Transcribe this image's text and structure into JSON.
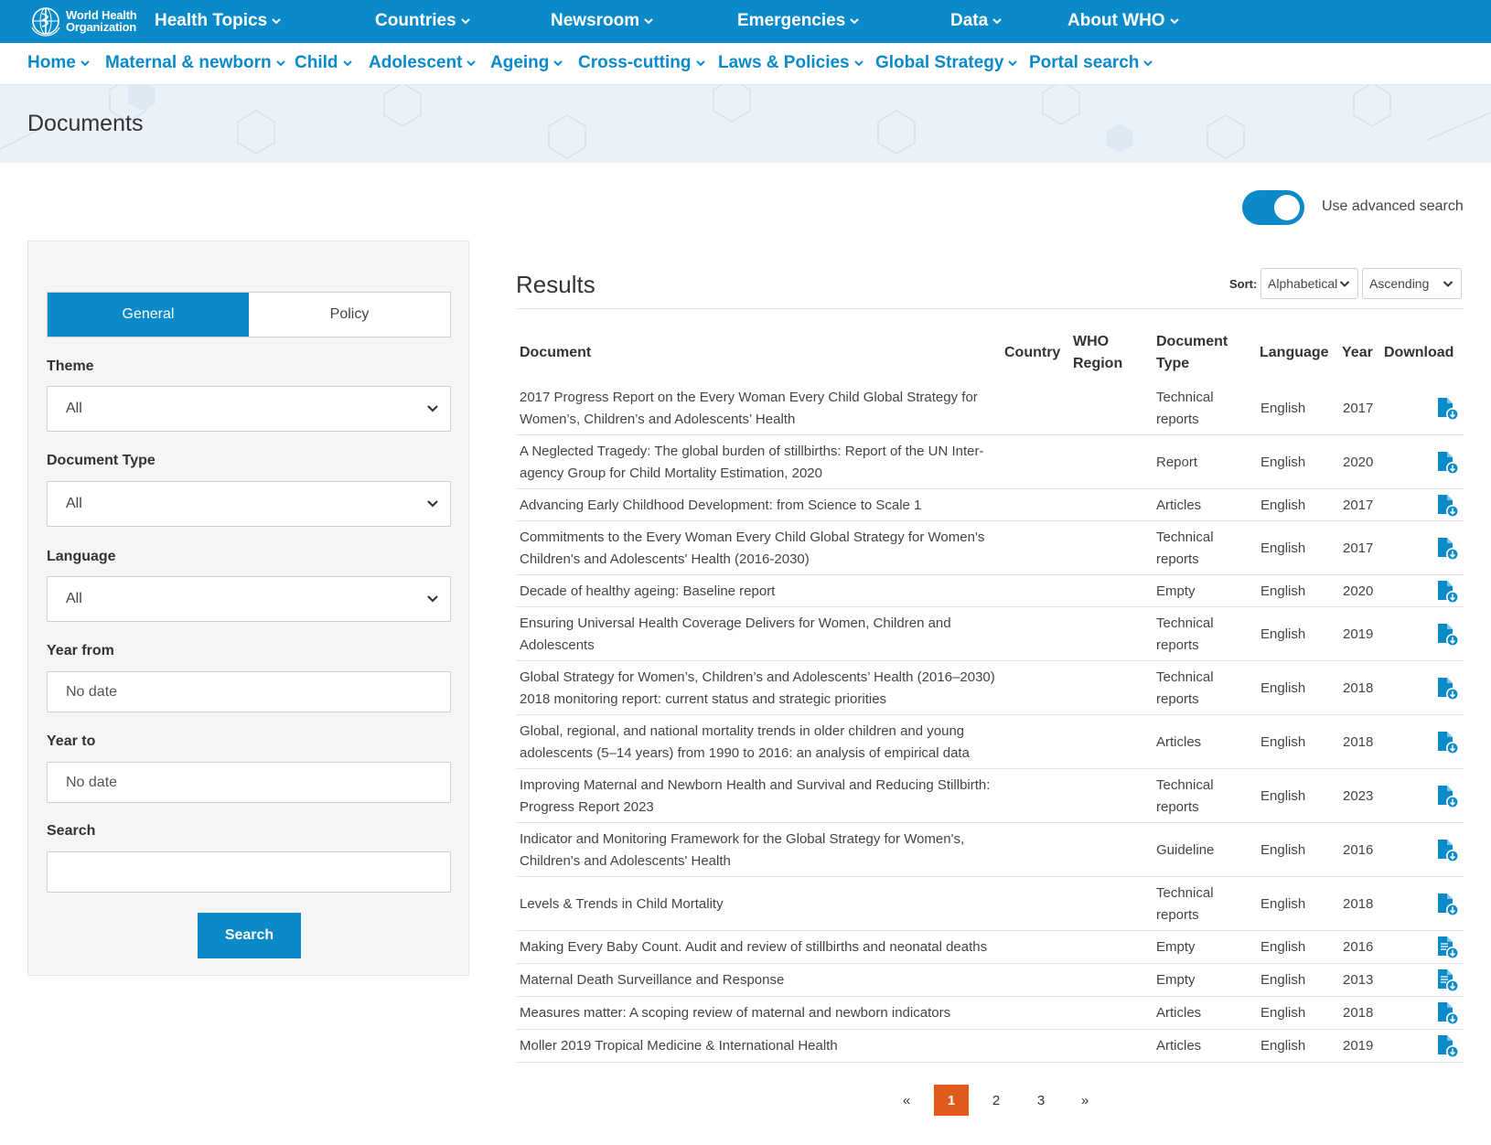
{
  "logo": {
    "line1": "World Health",
    "line2": "Organization",
    "icon": "who-emblem-icon"
  },
  "topnav": [
    {
      "label": "Health Topics"
    },
    {
      "label": "Countries"
    },
    {
      "label": "Newsroom"
    },
    {
      "label": "Emergencies"
    },
    {
      "label": "Data"
    },
    {
      "label": "About WHO"
    }
  ],
  "subnav": [
    {
      "label": "Home"
    },
    {
      "label": "Maternal & newborn"
    },
    {
      "label": "Child"
    },
    {
      "label": "Adolescent"
    },
    {
      "label": "Ageing"
    },
    {
      "label": "Cross-cutting"
    },
    {
      "label": "Laws & Policies"
    },
    {
      "label": "Global Strategy"
    },
    {
      "label": "Portal search"
    }
  ],
  "banner": {
    "title": "Documents"
  },
  "advanced_search": {
    "label": "Use advanced search",
    "enabled": true
  },
  "filters": {
    "tabs": [
      {
        "label": "General",
        "active": true
      },
      {
        "label": "Policy",
        "active": false
      }
    ],
    "theme": {
      "label": "Theme",
      "value": "All"
    },
    "doc_type": {
      "label": "Document Type",
      "value": "All"
    },
    "language": {
      "label": "Language",
      "value": "All"
    },
    "year_from": {
      "label": "Year from",
      "value": "No date"
    },
    "year_to": {
      "label": "Year to",
      "value": "No date"
    },
    "search": {
      "label": "Search",
      "value": ""
    },
    "search_button": "Search"
  },
  "results": {
    "title": "Results",
    "sort_label": "Sort:",
    "sort_field": "Alphabetical",
    "sort_order": "Ascending",
    "columns": {
      "document": "Document",
      "country": "Country",
      "region_1": "WHO",
      "region_2": "Region",
      "type_1": "Document",
      "type_2": "Type",
      "language": "Language",
      "year": "Year",
      "download": "Download"
    },
    "rows": [
      {
        "doc1": "2017 Progress Report on the Every Woman Every Child Global Strategy for",
        "doc2": "Women’s, Children’s and Adolescents’ Health",
        "type1": "Technical",
        "type2": "reports",
        "language": "English",
        "year": "2017",
        "icon": "file-download-icon"
      },
      {
        "doc1": "A Neglected Tragedy: The global burden of stillbirths: Report of the UN Inter-",
        "doc2": "agency Group for Child Mortality Estimation, 2020",
        "type1": "Report",
        "type2": "",
        "language": "English",
        "year": "2020",
        "icon": "file-download-icon"
      },
      {
        "doc1": "Advancing Early Childhood Development: from Science to Scale 1",
        "doc2": "",
        "type1": "Articles",
        "type2": "",
        "language": "English",
        "year": "2017",
        "icon": "file-download-icon"
      },
      {
        "doc1": "Commitments to the Every Woman Every Child Global Strategy for Women's",
        "doc2": "Children's and Adolescents' Health (2016-2030)",
        "type1": "Technical",
        "type2": "reports",
        "language": "English",
        "year": "2017",
        "icon": "file-download-icon"
      },
      {
        "doc1": "Decade of healthy ageing: Baseline report",
        "doc2": "",
        "type1": "Empty",
        "type2": "",
        "language": "English",
        "year": "2020",
        "icon": "file-download-icon"
      },
      {
        "doc1": "Ensuring Universal Health Coverage Delivers for Women, Children and",
        "doc2": "Adolescents",
        "type1": "Technical",
        "type2": "reports",
        "language": "English",
        "year": "2019",
        "icon": "file-download-icon"
      },
      {
        "doc1": "Global Strategy for Women’s, Children’s and Adolescents’ Health (2016–2030)",
        "doc2": "2018 monitoring report: current status and strategic priorities",
        "type1": "Technical",
        "type2": "reports",
        "language": "English",
        "year": "2018",
        "icon": "file-download-icon"
      },
      {
        "doc1": "Global, regional, and national mortality trends in older children and young",
        "doc2": "adolescents (5–14 years) from 1990 to 2016: an analysis of empirical data",
        "type1": "Articles",
        "type2": "",
        "language": "English",
        "year": "2018",
        "icon": "file-download-icon"
      },
      {
        "doc1": "Improving Maternal and Newborn Health and Survival and Reducing Stillbirth:",
        "doc2": "Progress Report 2023",
        "type1": "Technical",
        "type2": "reports",
        "language": "English",
        "year": "2023",
        "icon": "file-download-icon"
      },
      {
        "doc1": "Indicator and Monitoring Framework for the Global Strategy for Women's,",
        "doc2": "Children's and Adolescents' Health",
        "type1": "Guideline",
        "type2": "",
        "language": "English",
        "year": "2016",
        "icon": "file-download-icon"
      },
      {
        "doc1": "Levels & Trends in Child Mortality",
        "doc2": "",
        "type1": "Technical",
        "type2": "reports",
        "language": "English",
        "year": "2018",
        "icon": "file-download-icon"
      },
      {
        "doc1": "Making Every Baby Count. Audit and review of stillbirths and neonatal deaths",
        "doc2": "",
        "type1": "Empty",
        "type2": "",
        "language": "English",
        "year": "2016",
        "icon": "text-file-download-icon"
      },
      {
        "doc1": "Maternal Death Surveillance and Response",
        "doc2": "",
        "type1": "Empty",
        "type2": "",
        "language": "English",
        "year": "2013",
        "icon": "text-file-download-icon"
      },
      {
        "doc1": "Measures matter: A scoping review of maternal and newborn indicators",
        "doc2": "",
        "type1": "Articles",
        "type2": "",
        "language": "English",
        "year": "2018",
        "icon": "file-download-icon"
      },
      {
        "doc1": "Moller 2019 Tropical Medicine & International Health",
        "doc2": "",
        "type1": "Articles",
        "type2": "",
        "language": "English",
        "year": "2019",
        "icon": "file-download-icon"
      }
    ]
  },
  "pagination": {
    "prev": "«",
    "pages": [
      "1",
      "2",
      "3"
    ],
    "current": "1",
    "next": "»"
  },
  "colors": {
    "brand": "#0a8ac9",
    "active_page": "#e05a1c"
  }
}
